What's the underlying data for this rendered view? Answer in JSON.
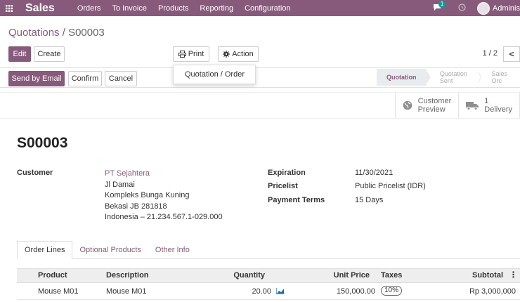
{
  "navbar": {
    "brand": "Sales",
    "menu": [
      "Orders",
      "To Invoice",
      "Products",
      "Reporting",
      "Configuration"
    ],
    "chat_badge": "1",
    "user": "Adminis"
  },
  "breadcrumb": {
    "parent": "Quotations",
    "separator": "/",
    "current": "S00003"
  },
  "toolbar": {
    "edit": "Edit",
    "create": "Create",
    "print": "Print",
    "action": "Action",
    "pager": "1 / 2",
    "pager_next": "<"
  },
  "print_menu": {
    "item": "Quotation / Order"
  },
  "header_buttons": {
    "send_email": "Send by Email",
    "confirm": "Confirm",
    "cancel": "Cancel"
  },
  "statusbar": [
    "Quotation",
    "Quotation Sent",
    "Sales Orc"
  ],
  "smart_buttons": {
    "preview": [
      "Customer",
      "Preview"
    ],
    "delivery": [
      "1",
      "Delivery"
    ]
  },
  "record": {
    "name": "S00003",
    "customer_label": "Customer",
    "customer_name": "PT Sejahtera",
    "address": [
      "Jl Damai",
      "Kompleks Bunga Kuning",
      "Bekasi JB 281818",
      "Indonesia – 21.234.567.1-029.000"
    ],
    "expiration_label": "Expiration",
    "expiration": "11/30/2021",
    "pricelist_label": "Pricelist",
    "pricelist": "Public Pricelist (IDR)",
    "payment_terms_label": "Payment Terms",
    "payment_terms": "15 Days"
  },
  "tabs": [
    "Order Lines",
    "Optional Products",
    "Other Info"
  ],
  "table": {
    "headers": {
      "product": "Product",
      "description": "Description",
      "quantity": "Quantity",
      "unit_price": "Unit Price",
      "taxes": "Taxes",
      "subtotal": "Subtotal"
    },
    "rows": [
      {
        "product": "Mouse M01",
        "description": "Mouse M01",
        "quantity": "20.00",
        "unit_price": "150,000.00",
        "taxes": "10%",
        "subtotal": "Rp 3,000,000"
      }
    ]
  },
  "colors": {
    "brand": "#875a7b",
    "accent": "#00a09d"
  }
}
